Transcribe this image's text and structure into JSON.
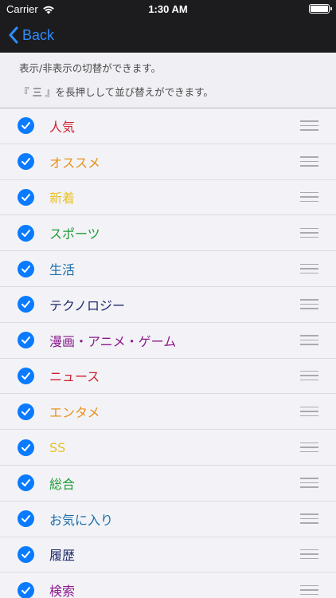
{
  "status_bar": {
    "carrier": "Carrier",
    "time": "1:30 AM"
  },
  "nav": {
    "back_label": "Back"
  },
  "info": {
    "line1": "表示/非表示の切替ができます。",
    "line2": "『 三 』を長押しして並び替えができます。"
  },
  "items": [
    {
      "label": "人気",
      "color": "#d0202c",
      "checked": true
    },
    {
      "label": "オススメ",
      "color": "#e8921c",
      "checked": true
    },
    {
      "label": "新着",
      "color": "#e8c02a",
      "checked": true
    },
    {
      "label": "スポーツ",
      "color": "#1f9b37",
      "checked": true
    },
    {
      "label": "生活",
      "color": "#1b6ea8",
      "checked": true
    },
    {
      "label": "テクノロジー",
      "color": "#1e2a6b",
      "checked": true
    },
    {
      "label": "漫画・アニメ・ゲーム",
      "color": "#8a1a8c",
      "checked": true
    },
    {
      "label": "ニュース",
      "color": "#d0202c",
      "checked": true
    },
    {
      "label": "エンタメ",
      "color": "#e8921c",
      "checked": true
    },
    {
      "label": "SS",
      "color": "#e8c02a",
      "checked": true
    },
    {
      "label": "総合",
      "color": "#1f9b37",
      "checked": true
    },
    {
      "label": "お気に入り",
      "color": "#1b6ea8",
      "checked": true
    },
    {
      "label": "履歴",
      "color": "#1e2a6b",
      "checked": true
    },
    {
      "label": "検索",
      "color": "#8a1a8c",
      "checked": true
    }
  ]
}
